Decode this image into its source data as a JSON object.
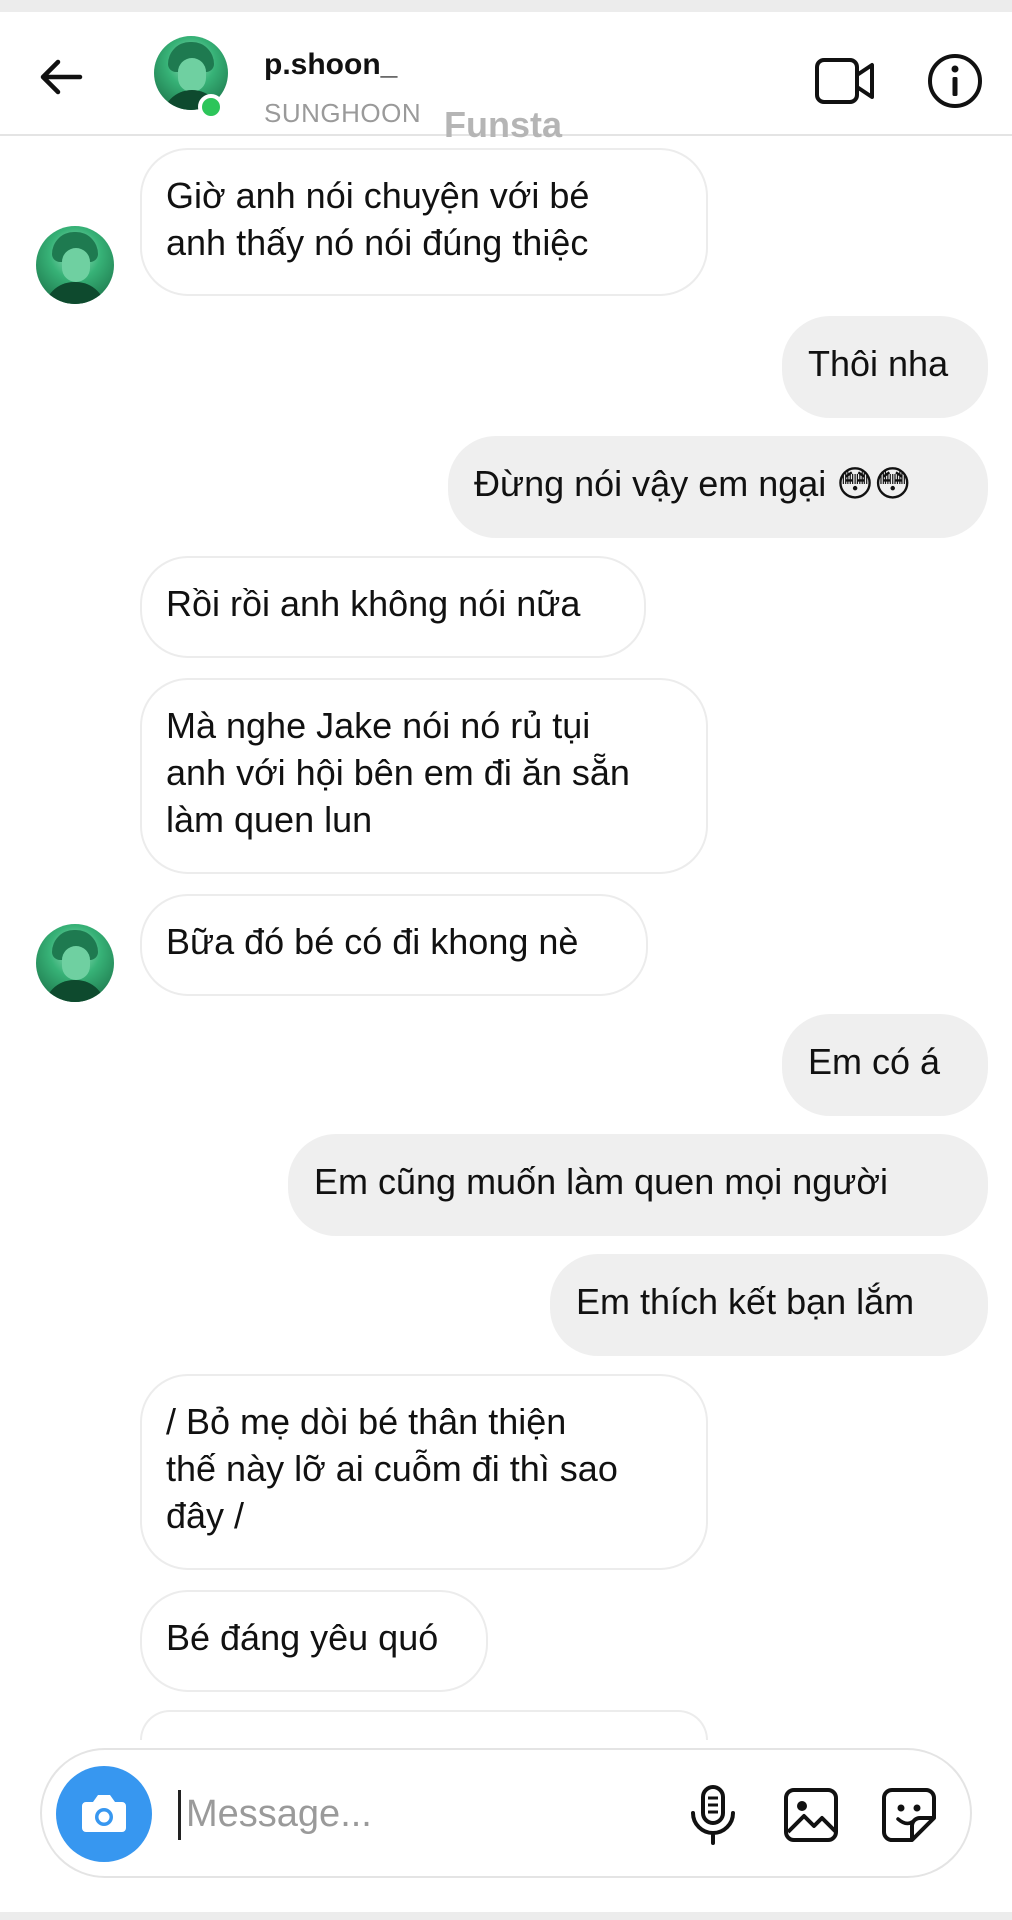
{
  "header": {
    "username": "p.shoon_",
    "real_name": "SUNGHOON",
    "watermark": "Funsta"
  },
  "messages": [
    {
      "from": "them",
      "lines": [
        "Giờ anh nói chuyện với bé",
        "anh thấy nó nói đúng thiệc"
      ]
    },
    {
      "from": "me",
      "lines": [
        "Thôi nha"
      ]
    },
    {
      "from": "me",
      "lines": [
        "Đừng nói vậy em ngại 😳😳"
      ]
    },
    {
      "from": "them",
      "lines": [
        "Rồi rồi anh không nói nữa"
      ]
    },
    {
      "from": "them",
      "lines": [
        "Mà nghe Jake nói nó rủ tụi",
        "anh với hội bên em đi ăn sẵn",
        "làm quen lun"
      ]
    },
    {
      "from": "them",
      "lines": [
        "Bữa đó bé có đi khong nè"
      ]
    },
    {
      "from": "me",
      "lines": [
        "Em có á"
      ]
    },
    {
      "from": "me",
      "lines": [
        "Em cũng muốn làm quen mọi người"
      ]
    },
    {
      "from": "me",
      "lines": [
        "Em thích kết bạn lắm"
      ]
    },
    {
      "from": "them",
      "lines": [
        "/ Bỏ mẹ dòi bé thân thiện",
        "thế này lỡ ai cuỗm đi thì sao",
        "đây /"
      ]
    },
    {
      "from": "them",
      "lines": [
        "Bé đáng yêu quó"
      ]
    }
  ],
  "composer": {
    "placeholder": "Message..."
  },
  "icons": {
    "back": "arrow-left-icon",
    "video": "video-camera-icon",
    "info": "info-icon",
    "camera": "camera-icon",
    "mic": "microphone-icon",
    "gallery": "gallery-icon",
    "sticker": "sticker-icon"
  },
  "colors": {
    "accent_blue": "#3797f0",
    "online_green": "#2dc55a",
    "sent_bubble": "#efefef"
  }
}
